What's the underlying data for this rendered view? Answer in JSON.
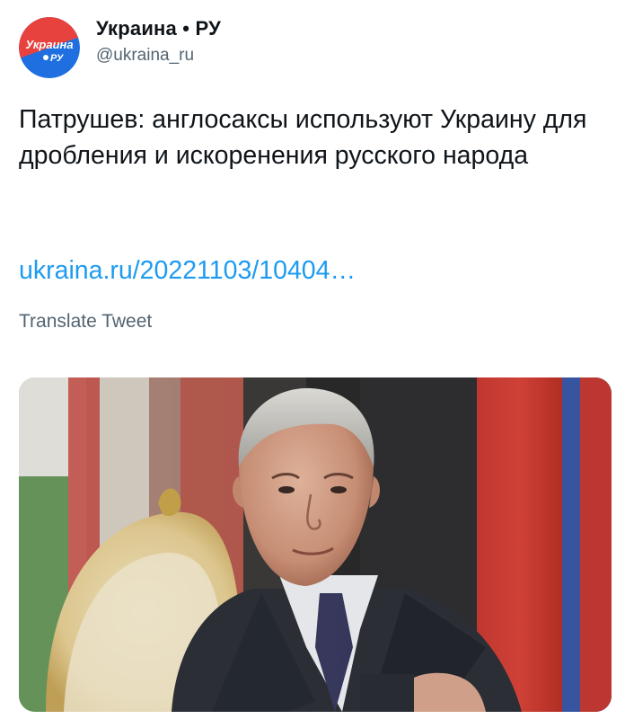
{
  "tweet": {
    "author": {
      "display_name": "Украина • РУ",
      "handle": "@ukraina_ru",
      "avatar_text_line1": "Украина",
      "avatar_text_line2": "РУ",
      "avatar_colors": {
        "red": "#e8423f",
        "blue": "#1f6fe0"
      }
    },
    "text": "Патрушев: англосаксы используют Украину для дробления и искоренения русского народа",
    "link_text": "ukraina.ru/20221103/10404…",
    "translate_label": "Translate Tweet",
    "media": {
      "icon": "photo-of-man-in-suit"
    }
  },
  "colors": {
    "link": "#1d9bf0",
    "secondary_text": "#536471",
    "primary_text": "#0f1419"
  }
}
